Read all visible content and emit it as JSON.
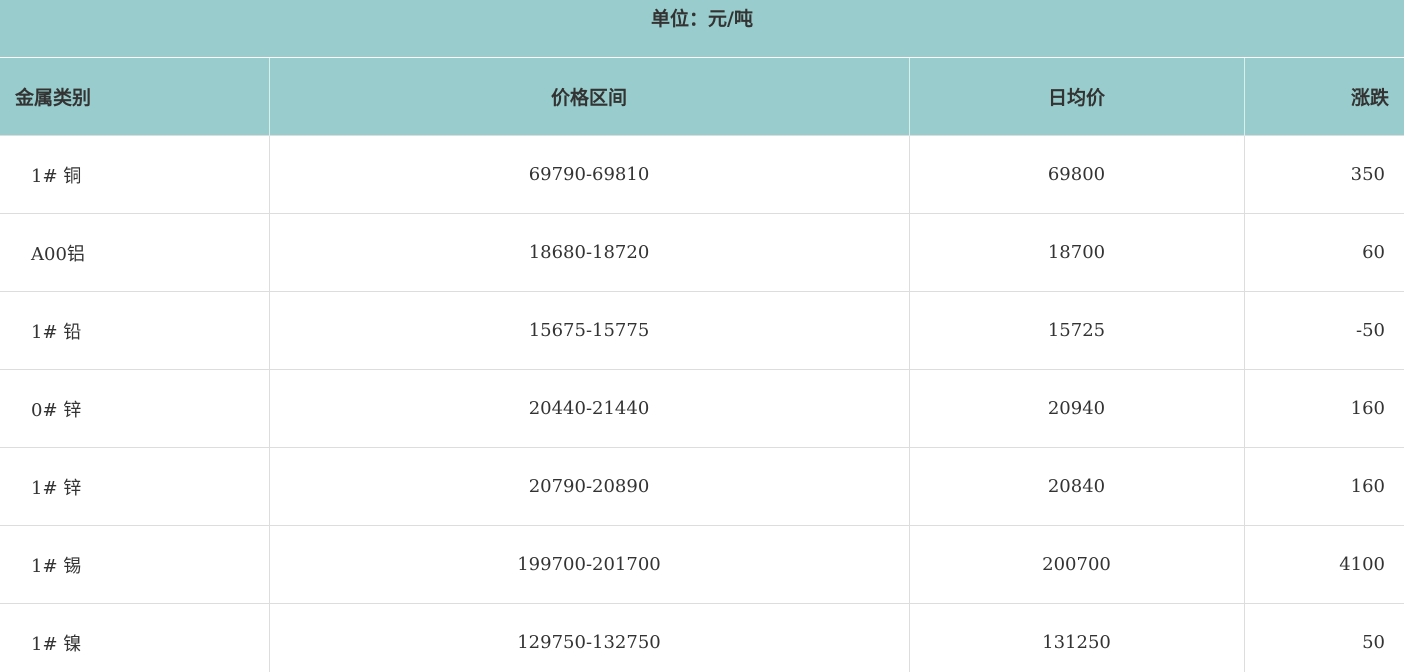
{
  "unit_label": "单位：元/吨",
  "headers": {
    "category": "金属类别",
    "range": "价格区间",
    "avg": "日均价",
    "change": "涨跌"
  },
  "rows": [
    {
      "category": "1# 铜",
      "range": "69790-69810",
      "avg": "69800",
      "change": "350"
    },
    {
      "category": "A00铝",
      "range": "18680-18720",
      "avg": "18700",
      "change": "60"
    },
    {
      "category": "1# 铅",
      "range": "15675-15775",
      "avg": "15725",
      "change": "-50"
    },
    {
      "category": "0# 锌",
      "range": "20440-21440",
      "avg": "20940",
      "change": "160"
    },
    {
      "category": "1# 锌",
      "range": "20790-20890",
      "avg": "20840",
      "change": "160"
    },
    {
      "category": "1# 锡",
      "range": "199700-201700",
      "avg": "200700",
      "change": "4100"
    },
    {
      "category": "1# 镍",
      "range": "129750-132750",
      "avg": "131250",
      "change": "50"
    }
  ],
  "colors": {
    "header_bg": "#99cccc",
    "text": "#333333",
    "grid": "#dddddd"
  }
}
